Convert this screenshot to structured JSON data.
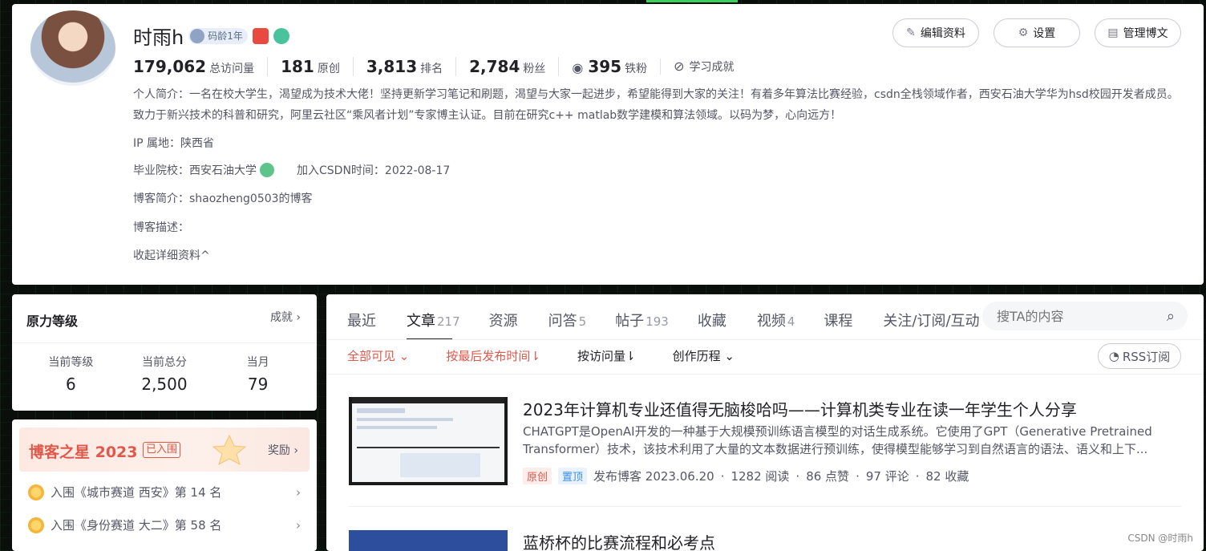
{
  "profile": {
    "name": "时雨h",
    "code_age": "码龄1年",
    "stats": [
      {
        "num": "179,062",
        "label": "总访问量"
      },
      {
        "num": "181",
        "label": "原创"
      },
      {
        "num": "3,813",
        "label": "排名"
      },
      {
        "num": "2,784",
        "label": "粉丝"
      },
      {
        "num": "395",
        "label": "铁粉"
      }
    ],
    "learning": "学习成就",
    "intro": "个人简介：一名在校大学生，渴望成为技术大佬！坚持更新学习笔记和刷题，渴望与大家一起进步，希望能得到大家的关注！有着多年算法比赛经验，csdn全栈领域作者，西安石油大学华为hsd校园开发者成员。致力于新兴技术的科普和研究，阿里云社区“乘风者计划”专家博主认证。目前在研究c++ matlab数学建模和算法领域。以码为梦，心向远方！",
    "ip": "IP 属地：陕西省",
    "school": "毕业院校：西安石油大学",
    "joined": "加入CSDN时间：2022-08-17",
    "blog_intro": "博客简介：shaozheng0503的博客",
    "blog_desc": "博客描述：",
    "collapse": "收起详细资料"
  },
  "actions": {
    "edit": "编辑资料",
    "settings": "设置",
    "manage": "管理博文"
  },
  "level": {
    "title": "原力等级",
    "link": "成就",
    "cols": [
      {
        "label": "当前等级",
        "value": "6"
      },
      {
        "label": "当前总分",
        "value": "2,500"
      },
      {
        "label": "当月",
        "value": "79"
      }
    ]
  },
  "star": {
    "title": "博客之星 2023",
    "tag": "已入围",
    "reward": "奖励",
    "items": [
      "入围《城市赛道 西安》第 14 名",
      "入围《身份赛道 大二》第 58 名"
    ]
  },
  "tabs": [
    {
      "label": "最近",
      "count": ""
    },
    {
      "label": "文章",
      "count": "217"
    },
    {
      "label": "资源",
      "count": ""
    },
    {
      "label": "问答",
      "count": "5"
    },
    {
      "label": "帖子",
      "count": "193"
    },
    {
      "label": "收藏",
      "count": ""
    },
    {
      "label": "视频",
      "count": "4"
    },
    {
      "label": "课程",
      "count": ""
    },
    {
      "label": "关注/订阅/互动",
      "count": ""
    }
  ],
  "search": {
    "placeholder": "搜TA的内容"
  },
  "filters": {
    "visibility": "全部可见",
    "sort_latest": "按最后发布时间",
    "sort_views": "按访问量",
    "history": "创作历程",
    "rss": "RSS订阅"
  },
  "articles": [
    {
      "title": "2023年计算机专业还值得无脑梭哈吗——计算机类专业在读一年学生个人分享",
      "desc": "CHATGPT是OpenAI开发的一种基于大规模预训练语言模型的对话生成系统。它使用了GPT（Generative Pretrained Transformer）技术，该技术利用了大量的文本数据进行预训练，使得模型能够学习到自然语言的语法、语义和上下...",
      "tag1": "原创",
      "tag2": "置顶",
      "date": "发布博客 2023.06.20",
      "reads": "1282 阅读",
      "likes": "86 点赞",
      "comments": "97 评论",
      "favs": "82 收藏"
    },
    {
      "title": "蓝桥杯的比赛流程和必考点"
    }
  ],
  "watermark": "CSDN @时雨h"
}
